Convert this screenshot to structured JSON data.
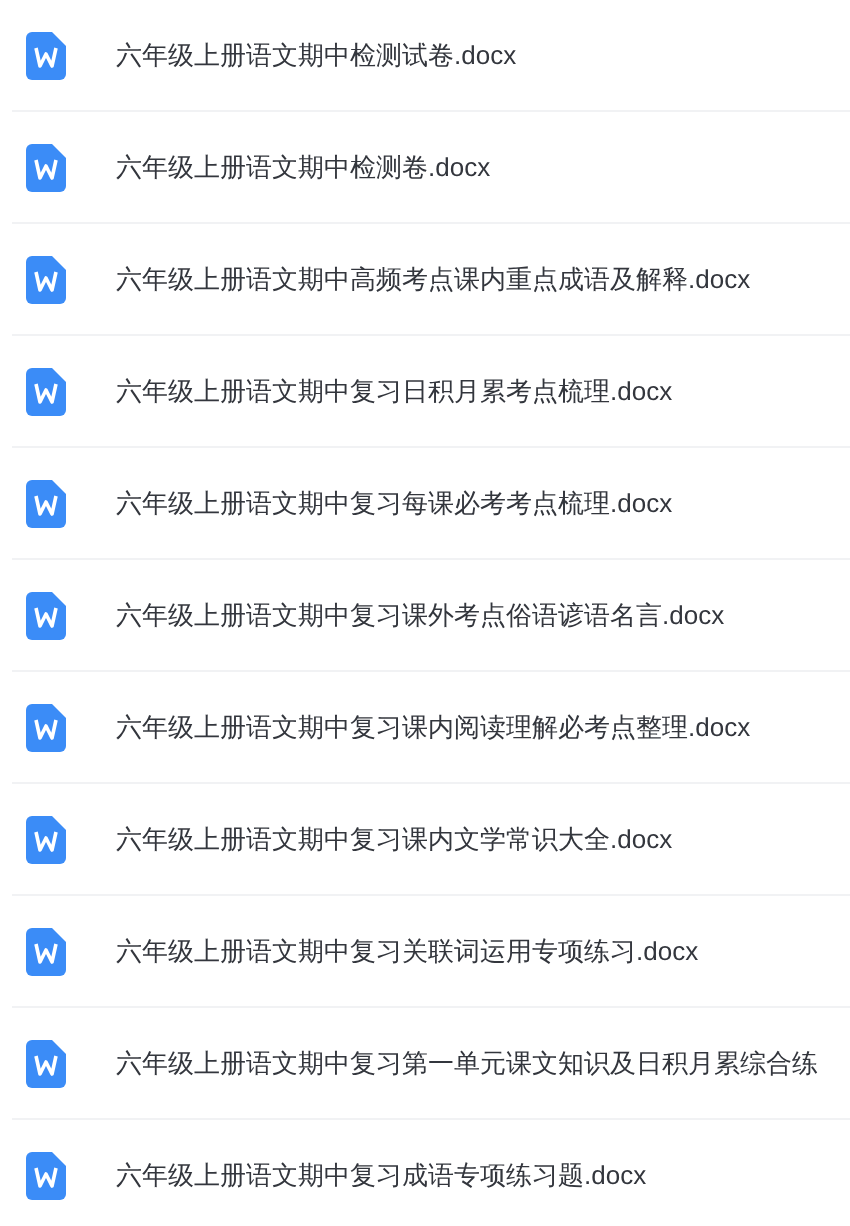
{
  "files": [
    {
      "name": "六年级上册语文期中检测试卷.docx"
    },
    {
      "name": "六年级上册语文期中检测卷.docx"
    },
    {
      "name": "六年级上册语文期中高频考点课内重点成语及解释.docx"
    },
    {
      "name": "六年级上册语文期中复习日积月累考点梳理.docx"
    },
    {
      "name": "六年级上册语文期中复习每课必考考点梳理.docx"
    },
    {
      "name": "六年级上册语文期中复习课外考点俗语谚语名言.docx"
    },
    {
      "name": "六年级上册语文期中复习课内阅读理解必考点整理.docx"
    },
    {
      "name": "六年级上册语文期中复习课内文学常识大全.docx"
    },
    {
      "name": "六年级上册语文期中复习关联词运用专项练习.docx"
    },
    {
      "name": "六年级上册语文期中复习第一单元课文知识及日积月累综合练"
    },
    {
      "name": "六年级上册语文期中复习成语专项练习题.docx"
    }
  ]
}
